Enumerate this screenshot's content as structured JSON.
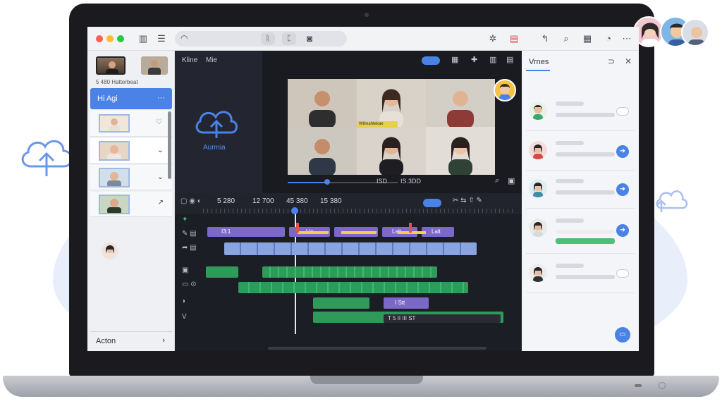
{
  "colors": {
    "accent": "#4b82e6",
    "green": "#2f9a5a",
    "purple": "#7b68c9",
    "yellow": "#f2d14a",
    "red": "#e0524a"
  },
  "left_panel": {
    "thumb_caption": "5 480 Hatterbeat",
    "active_item": "Hi Agi",
    "active_more": "···",
    "footer_label": "Acton",
    "footer_icon": "chevron-right-icon"
  },
  "media_panel": {
    "tab_1": "Kline",
    "tab_2": "Mie",
    "upload_label": "Aurmia"
  },
  "preview": {
    "caption": "Wlimahtekae",
    "timecode": "ISD",
    "timecode_2": "IS.3DD"
  },
  "timeline": {
    "times": [
      "5 280",
      "12 700",
      "45 380",
      "15 380"
    ],
    "clip_label_1": "I3:1",
    "clip_label_2": "Lle",
    "clip_label_3": "Lalt",
    "clip_label_4": "Lalt",
    "caption_clip": "I Stt",
    "caption_clip_2": "T 5 II III ST"
  },
  "right_panel": {
    "title": "Vrnes",
    "rows": 5
  }
}
